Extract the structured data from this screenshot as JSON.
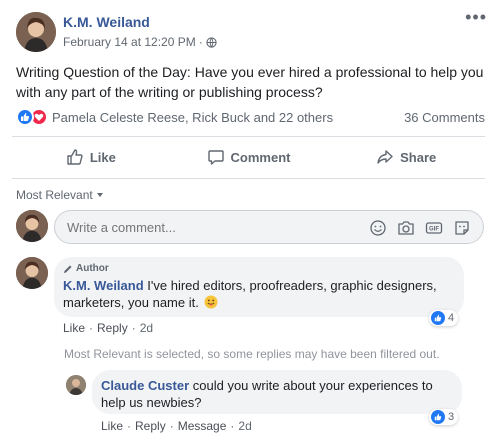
{
  "post": {
    "author": "K.M. Weiland",
    "date": "February 14 at 12:20 PM",
    "separator": "·",
    "more": "•••",
    "text": "Writing Question of the Day: Have you ever hired a professional to help you with any part of the writing or publishing process?",
    "reactors": "Pamela Celeste Reese, Rick Buck and 22 others",
    "comment_count": "36 Comments"
  },
  "actions": {
    "like": "Like",
    "comment": "Comment",
    "share": "Share"
  },
  "sort": {
    "label": "Most Relevant"
  },
  "composer": {
    "placeholder": "Write a comment..."
  },
  "comments": [
    {
      "badge": "Author",
      "name": "K.M. Weiland",
      "text": "I've hired editors, proofreaders, graphic designers, marketers, you name it.",
      "like": "Like",
      "reply": "Reply",
      "time": "2d",
      "likes": "4"
    }
  ],
  "filter_note": "Most Relevant is selected, so some replies may have been filtered out.",
  "replies": [
    {
      "name": "Claude Custer",
      "text": "could you write about your experiences to help us newbies?",
      "like": "Like",
      "reply": "Reply",
      "message": "Message",
      "time": "2d",
      "likes": "3"
    }
  ],
  "icons": {
    "more": "more-options-icon",
    "globe": "globe-icon",
    "like_reaction": "like-reaction-icon",
    "love_reaction": "love-reaction-icon",
    "thumbs_up": "thumbs-up-icon",
    "comment": "comment-icon",
    "share": "share-icon",
    "emoji": "emoji-icon",
    "camera": "camera-icon",
    "gif": "gif-icon",
    "sticker": "sticker-icon",
    "pencil": "pencil-icon",
    "tongue_emoji": "tongue-out-emoji-icon"
  },
  "colors": {
    "link_blue": "#385898",
    "like_blue": "#2078f4",
    "love_red": "#f0284a",
    "secondary_text": "#606770",
    "bubble_bg": "#f2f3f5"
  }
}
